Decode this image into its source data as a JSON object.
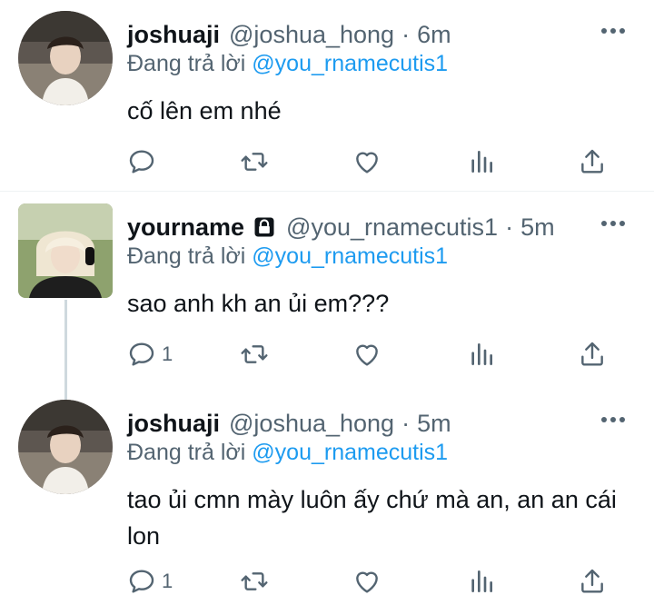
{
  "tweets": [
    {
      "name": "joshuaji",
      "handle": "@joshua_hong",
      "dot": "·",
      "time": "6m",
      "replying_prefix": "Đang trả lời",
      "replying_to": "@you_rnamecutis1",
      "text": "cố lên em nhé",
      "reply_count": "",
      "avatar_icon": "user-avatar-joshuaji"
    },
    {
      "name": "yourname",
      "handle": "@you_rnamecutis1",
      "dot": "·",
      "time": "5m",
      "replying_prefix": "Đang trả lời",
      "replying_to": "@you_rnamecutis1",
      "text": "sao anh kh an ủi em???",
      "reply_count": "1",
      "avatar_icon": "user-avatar-yourname",
      "locked": true
    },
    {
      "name": "joshuaji",
      "handle": "@joshua_hong",
      "dot": "·",
      "time": "5m",
      "replying_prefix": "Đang trả lời",
      "replying_to": "@you_rnamecutis1",
      "text": "tao ủi cmn mày luôn ấy chứ mà an, an an cái lon",
      "reply_count": "1",
      "avatar_icon": "user-avatar-joshuaji"
    }
  ],
  "icons": [
    "reply-icon",
    "retweet-icon",
    "like-icon",
    "analytics-icon",
    "share-icon",
    "more-icon",
    "lock-icon"
  ],
  "colors": {
    "accent": "#1d9bf0",
    "secondary_text": "#536471",
    "divider": "#eff3f4"
  }
}
